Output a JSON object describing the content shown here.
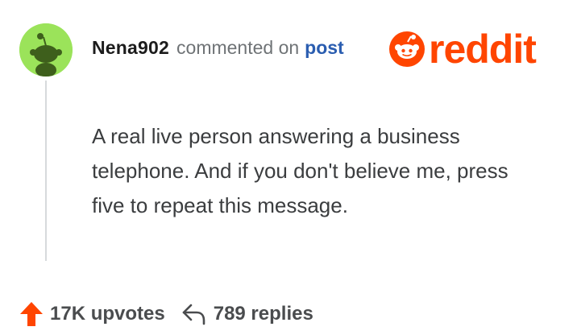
{
  "comment": {
    "author": "Nena902",
    "action_text": "commented on",
    "post_link": "post",
    "body": "A real live person answering a business telephone. And if you don't believe me, press five to repeat this message."
  },
  "brand": {
    "name": "reddit",
    "color": "#ff4500"
  },
  "stats": {
    "upvotes": "17K upvotes",
    "replies": "789 replies"
  },
  "colors": {
    "avatar_bg": "#9be35a",
    "link": "#2a5db0",
    "upvote": "#ff4500"
  },
  "icons": {
    "avatar": "snoo-avatar-icon",
    "logo": "reddit-snoo-icon",
    "upvote": "upvote-arrow-icon",
    "reply": "reply-arrow-icon"
  }
}
